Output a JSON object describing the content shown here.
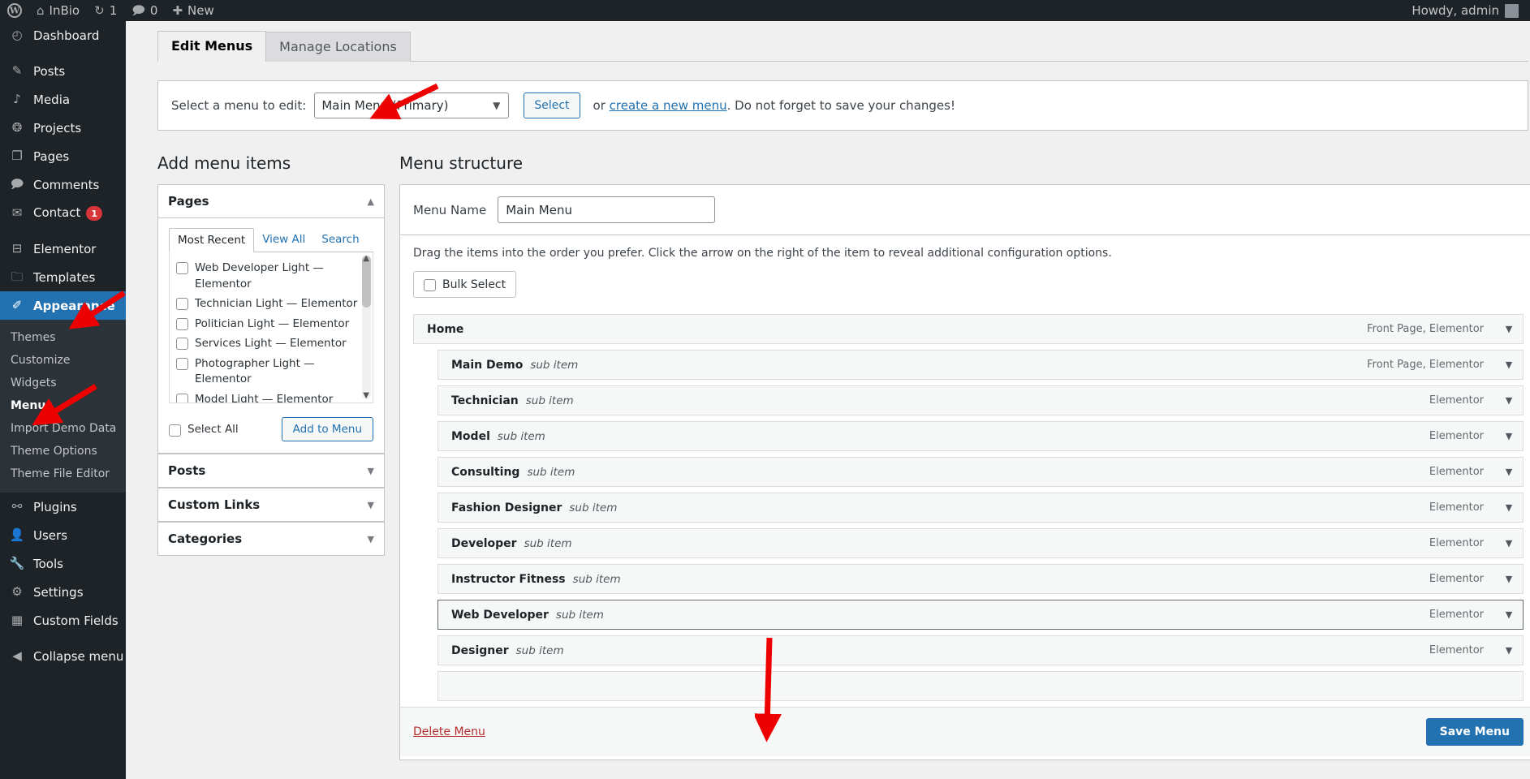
{
  "adminbar": {
    "site_name": "InBio",
    "updates_count": "1",
    "comments_count": "0",
    "new_label": "New",
    "account_greeting": "Howdy, admin",
    "icons": {
      "wp": "wordpress-logo-icon",
      "home": "home-icon",
      "updates": "updates-icon",
      "comments": "comment-icon",
      "new": "plus-icon"
    }
  },
  "sidebar": {
    "items": [
      {
        "label": "Dashboard",
        "icon": "dashboard-icon",
        "glyph": "◴",
        "gap_after": true
      },
      {
        "label": "Posts",
        "icon": "pin-icon",
        "glyph": "✎",
        "gap_after": false
      },
      {
        "label": "Media",
        "icon": "media-icon",
        "glyph": "♪",
        "gap_after": false
      },
      {
        "label": "Projects",
        "icon": "projects-icon",
        "glyph": "❂",
        "gap_after": false
      },
      {
        "label": "Pages",
        "icon": "pages-icon",
        "glyph": "❐",
        "gap_after": false
      },
      {
        "label": "Comments",
        "icon": "comment-icon",
        "glyph": "🗩",
        "gap_after": false
      },
      {
        "label": "Contact",
        "icon": "mail-icon",
        "glyph": "✉",
        "badge": "1",
        "gap_after": true
      },
      {
        "label": "Elementor",
        "icon": "elementor-icon",
        "glyph": "⊟",
        "gap_after": false
      },
      {
        "label": "Templates",
        "icon": "folder-icon",
        "glyph": "🗀",
        "gap_after": false
      },
      {
        "label": "Appearance",
        "icon": "brush-icon",
        "glyph": "✐",
        "current": true,
        "gap_after": false
      }
    ],
    "submenu": [
      {
        "label": "Themes"
      },
      {
        "label": "Customize"
      },
      {
        "label": "Widgets"
      },
      {
        "label": "Menus",
        "current": true
      },
      {
        "label": "Import Demo Data"
      },
      {
        "label": "Theme Options"
      },
      {
        "label": "Theme File Editor"
      }
    ],
    "items_after": [
      {
        "label": "Plugins",
        "icon": "plug-icon",
        "glyph": "⚯",
        "gap_after": false
      },
      {
        "label": "Users",
        "icon": "user-icon",
        "glyph": "👤",
        "gap_after": false
      },
      {
        "label": "Tools",
        "icon": "wrench-icon",
        "glyph": "🔧",
        "gap_after": false
      },
      {
        "label": "Settings",
        "icon": "settings-icon",
        "glyph": "⚙",
        "gap_after": false
      },
      {
        "label": "Custom Fields",
        "icon": "table-icon",
        "glyph": "▦",
        "gap_after": true
      },
      {
        "label": "Collapse menu",
        "icon": "collapse-icon",
        "glyph": "◀",
        "gap_after": false
      }
    ]
  },
  "tabs": [
    {
      "label": "Edit Menus",
      "active": true
    },
    {
      "label": "Manage Locations",
      "active": false
    }
  ],
  "menu_select": {
    "label": "Select a menu to edit:",
    "selected": "Main Menu (Primary)",
    "options": [
      "Main Menu (Primary)"
    ],
    "select_button": "Select",
    "suffix_before": "or ",
    "link_text": "create a new menu",
    "suffix_after": ". Do not forget to save your changes!"
  },
  "add_items": {
    "heading": "Add menu items",
    "panels": [
      {
        "title": "Pages",
        "expanded": true,
        "inner_tabs": [
          {
            "label": "Most Recent",
            "active": true
          },
          {
            "label": "View All",
            "active": false
          },
          {
            "label": "Search",
            "active": false
          }
        ],
        "checkboxes": [
          {
            "label": "Web Developer Light — Elementor",
            "checked": false
          },
          {
            "label": "Technician Light — Elementor",
            "checked": false
          },
          {
            "label": "Politician Light — Elementor",
            "checked": false
          },
          {
            "label": "Services Light — Elementor",
            "checked": false
          },
          {
            "label": "Photographer Light — Elementor",
            "checked": false
          },
          {
            "label": "Model Light — Elementor",
            "checked": false
          }
        ],
        "select_all_label": "Select All",
        "add_button": "Add to Menu"
      },
      {
        "title": "Posts",
        "expanded": false
      },
      {
        "title": "Custom Links",
        "expanded": false
      },
      {
        "title": "Categories",
        "expanded": false
      }
    ]
  },
  "structure": {
    "heading": "Menu structure",
    "menu_name_label": "Menu Name",
    "menu_name_value": "Main Menu",
    "drag_hint": "Drag the items into the order you prefer. Click the arrow on the right of the item to reveal additional configuration options.",
    "bulk_select_label": "Bulk Select",
    "items": [
      {
        "title": "Home",
        "sub": "",
        "meta": "Front Page, Elementor",
        "depth": 0,
        "selected": false
      },
      {
        "title": "Main Demo",
        "sub": "sub item",
        "meta": "Front Page, Elementor",
        "depth": 1,
        "selected": false
      },
      {
        "title": "Technician",
        "sub": "sub item",
        "meta": "Elementor",
        "depth": 1,
        "selected": false
      },
      {
        "title": "Model",
        "sub": "sub item",
        "meta": "Elementor",
        "depth": 1,
        "selected": false
      },
      {
        "title": "Consulting",
        "sub": "sub item",
        "meta": "Elementor",
        "depth": 1,
        "selected": false
      },
      {
        "title": "Fashion Designer",
        "sub": "sub item",
        "meta": "Elementor",
        "depth": 1,
        "selected": false
      },
      {
        "title": "Developer",
        "sub": "sub item",
        "meta": "Elementor",
        "depth": 1,
        "selected": false
      },
      {
        "title": "Instructor Fitness",
        "sub": "sub item",
        "meta": "Elementor",
        "depth": 1,
        "selected": false
      },
      {
        "title": "Web Developer",
        "sub": "sub item",
        "meta": "Elementor",
        "depth": 1,
        "selected": true
      },
      {
        "title": "Designer",
        "sub": "sub item",
        "meta": "Elementor",
        "depth": 1,
        "selected": false
      },
      {
        "title": "",
        "sub": "",
        "meta": "",
        "depth": 1,
        "selected": false
      }
    ],
    "delete_label": "Delete Menu",
    "save_label": "Save Menu"
  },
  "colors": {
    "accent": "#2271b1",
    "sidebar_bg": "#1d2327",
    "submenu_bg": "#2c3338",
    "annotation": "#ee0000",
    "danger": "#b32d2e",
    "badge": "#d63638"
  }
}
